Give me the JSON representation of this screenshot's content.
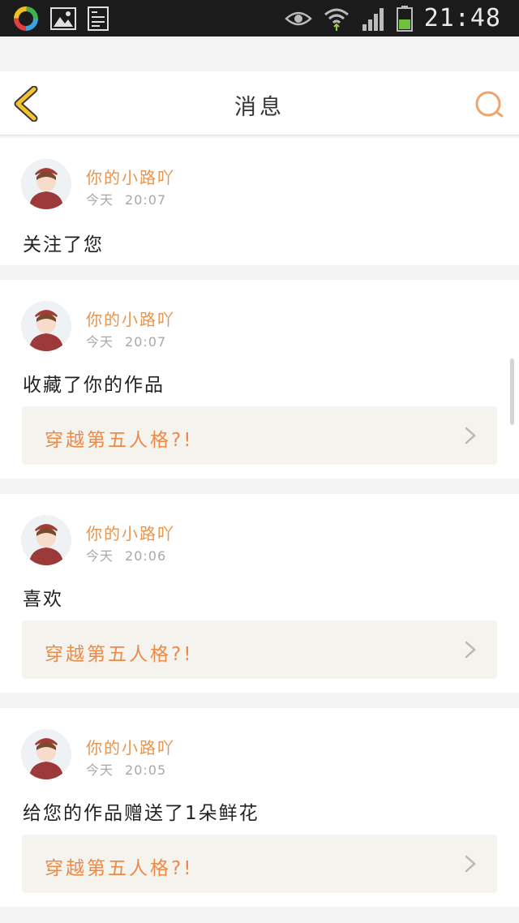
{
  "status_bar": {
    "time": "21:48",
    "left_icons": [
      "app-ring-icon",
      "gallery-icon",
      "stock-app-icon"
    ],
    "right_icons": [
      "eye-icon",
      "wifi-icon",
      "signal-icon",
      "battery-icon"
    ]
  },
  "header": {
    "title": "消息",
    "back_icon": "chevron-left-icon",
    "search_icon": "search-icon"
  },
  "colors": {
    "accent_orange": "#e8954f",
    "back_yellow": "#f3c230",
    "background": "#f3f3f3"
  },
  "messages": [
    {
      "user": "你的小路吖",
      "day": "今天",
      "time": "20:07",
      "action": "关注了您",
      "work": null
    },
    {
      "user": "你的小路吖",
      "day": "今天",
      "time": "20:07",
      "action": "收藏了你的作品",
      "work": "穿越第五人格?!"
    },
    {
      "user": "你的小路吖",
      "day": "今天",
      "time": "20:06",
      "action": "喜欢",
      "work": "穿越第五人格?!"
    },
    {
      "user": "你的小路吖",
      "day": "今天",
      "time": "20:05",
      "action": "给您的作品赠送了1朵鲜花",
      "work": "穿越第五人格?!"
    }
  ]
}
